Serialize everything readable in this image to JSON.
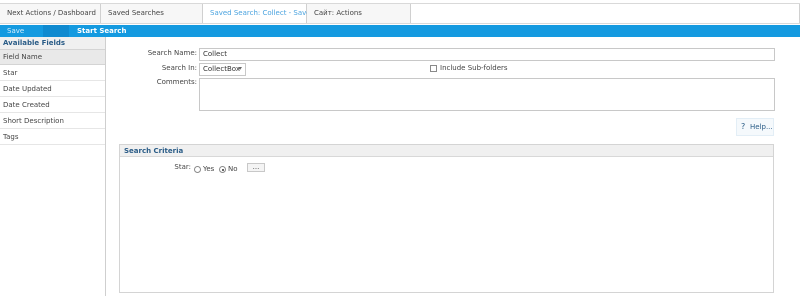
{
  "tabs": [
    {
      "label": "Next Actions / Dashboard"
    },
    {
      "label": "Saved Searches"
    },
    {
      "label": "Saved Search: Collect - Save"
    },
    {
      "label": "Сайт: Actions"
    }
  ],
  "toolbar": {
    "save_label": "Save",
    "start_label": "Start Search"
  },
  "left_panel": {
    "title": "Available Fields",
    "column_header": "Field Name",
    "items": [
      "Star",
      "Date Updated",
      "Date Created",
      "Short Description",
      "Tags"
    ]
  },
  "form": {
    "search_name_label": "Search Name:",
    "search_name_value": "Collect",
    "search_in_label": "Search In:",
    "search_in_value": "CollectBox",
    "include_subfolders_label": "Include Sub-folders",
    "include_subfolders_checked": false,
    "comments_label": "Comments:",
    "comments_value": "",
    "help_label": "Help..."
  },
  "criteria": {
    "title": "Search Criteria",
    "star_label": "Star:",
    "yes_label": "Yes",
    "no_label": "No",
    "selected": "No",
    "more_button_label": "..."
  },
  "colors": {
    "toolbar_bg": "#149ae0",
    "active_tab_text": "#4aa3df",
    "header_text": "#2a5c87"
  }
}
